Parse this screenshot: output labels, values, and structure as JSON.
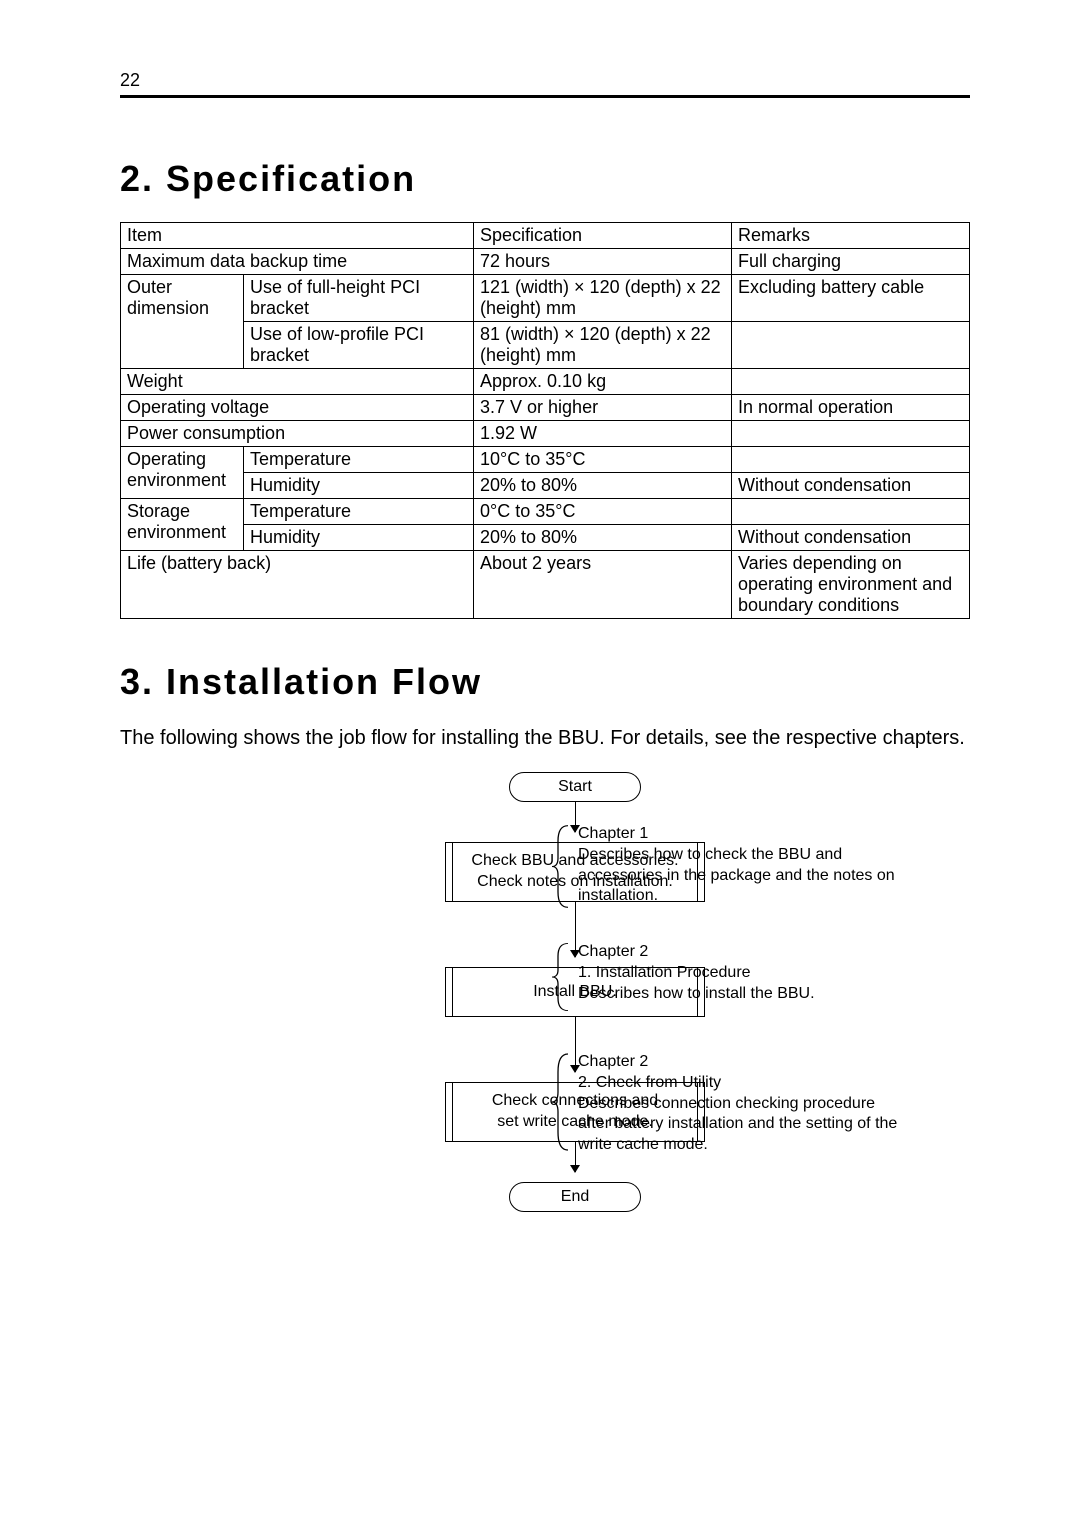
{
  "page_number": "22",
  "section_spec": {
    "heading": "2. Specification",
    "headers": {
      "item": "Item",
      "spec": "Specification",
      "remarks": "Remarks"
    },
    "rows": {
      "backup": {
        "item": "Maximum data backup time",
        "spec": "72 hours",
        "remarks": "Full charging"
      },
      "outerdim": {
        "label": "Outer dimension",
        "full": {
          "item": "Use of full-height PCI bracket",
          "spec": "121 (width) × 120 (depth) x 22 (height) mm",
          "remarks": "Excluding battery cable"
        },
        "low": {
          "item": "Use of low-profile PCI bracket",
          "spec": "81 (width) × 120 (depth) x 22 (height) mm",
          "remarks": ""
        }
      },
      "weight": {
        "item": "Weight",
        "spec": "Approx. 0.10 kg",
        "remarks": ""
      },
      "voltage": {
        "item": "Operating voltage",
        "spec": "3.7 V or higher",
        "remarks": "In normal operation"
      },
      "power": {
        "item": "Power consumption",
        "spec": "1.92 W",
        "remarks": ""
      },
      "openv": {
        "label": "Operating environment",
        "temp": {
          "item": "Temperature",
          "spec": "10°C to 35°C",
          "remarks": ""
        },
        "hum": {
          "item": "Humidity",
          "spec": "20% to 80%",
          "remarks": "Without condensation"
        }
      },
      "stenv": {
        "label": "Storage environment",
        "temp": {
          "item": "Temperature",
          "spec": "0°C to 35°C",
          "remarks": ""
        },
        "hum": {
          "item": "Humidity",
          "spec": "20% to 80%",
          "remarks": "Without condensation"
        }
      },
      "life": {
        "item": "Life (battery back)",
        "spec": "About 2 years",
        "remarks": "Varies depending on operating environment and boundary conditions"
      }
    }
  },
  "section_flow": {
    "heading": "3. Installation Flow",
    "intro": "The following shows the job flow for installing the BBU. For details, see the respective chapters.",
    "start": "Start",
    "end": "End",
    "step1": "Check BBU and accessories.\nCheck notes on installation.",
    "step2": "Install BBU.",
    "step3": "Check connections and\nset write cache mode.",
    "note1": "Chapter 1\nDescribes how to check the BBU and accessories in the package and the notes on installation.",
    "note2": "Chapter 2\n1. Installation Procedure\nDescribes how to install the BBU.",
    "note3": "Chapter 2\n2. Check from Utility\nDescribes connection checking procedure after battery installation and the setting of the write cache mode."
  }
}
